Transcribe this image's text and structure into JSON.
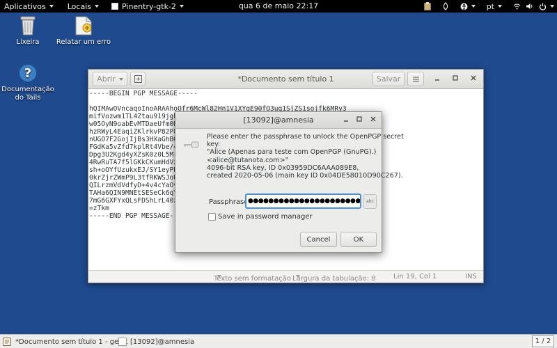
{
  "top_panel": {
    "applications": "Aplicativos",
    "places": "Locais",
    "app_menu": "Pinentry-gtk-2",
    "clock": "qua 6 de maio  22:17",
    "language": "pt"
  },
  "desktop": {
    "icons": [
      {
        "label": "Lixeira",
        "icon": "trash-icon"
      },
      {
        "label": "Relatar um erro",
        "icon": "report-bug-icon"
      },
      {
        "label": "Documentação do Tails",
        "icon": "help-icon"
      }
    ]
  },
  "gedit": {
    "title": "*Documento sem título 1",
    "open_label": "Abrir",
    "save_label": "Salvar",
    "lines": [
      "-----BEGIN PGP MESSAGE-----",
      "",
      "hQIMAwOVncaqoInoARAAhoOfr6McWl82Hn1V1XYqE90fO3uq1SjZS1sojfk6MRy3",
      "mifVozwm1TL4Ztau919jgh",
      "w05OyN9oabEvMTDaeUfm0K",
      "hzRWyL4EaqiZKlrkvP82P8",
      "nUGO7F2GojIjBs3HXaGhBQ",
      "FGdKa5vZfd7kplRt4Vbe/4",
      "Dpg3U2Kgd4yXZsK0z0L5Mr",
      "4RwRuTA7f5lGKkCKumHdVx",
      "sh+oOYfUzukxEJ/SY1eyPB",
      "0krZjrZWmP9L3tfRKWSJoU",
      "QILrzmVdVdfyD+4v4cYaOv",
      "TAHa6QIN9MNEtSESeCk6qY",
      "7mG6GXFYxQLsFDShLrL40z",
      "=zTkm",
      "-----END PGP MESSAGE-----"
    ],
    "status": {
      "format": "Texto sem formatação",
      "tab_width": "Largura da tabulação: 8",
      "position": "Lin 19, Col 1",
      "mode": "INS"
    }
  },
  "dialog": {
    "title": "[13092]@amnesia",
    "message_lines": [
      "Please enter the passphrase to unlock the OpenPGP secret",
      "key:",
      "\"Alice (Apenas para teste com OpenPGP (GnuPG).)",
      "<alice@tutanota.com>\"",
      "4096-bit RSA key, ID 0x03959DC6AAA089E8,",
      "created 2020-05-06 (main key ID 0x04DE58010D90C267)."
    ],
    "passphrase_label": "Passphrase:",
    "passphrase_value": "●●●●●●●●●●●●●●●●●●●●●●●●●●●●●●",
    "abc_label": "abc",
    "save_label": "Save in password manager",
    "cancel_label": "Cancel",
    "ok_label": "OK"
  },
  "taskbar": {
    "tasks": [
      {
        "label": "*Documento sem título 1 - gedit"
      },
      {
        "label": "[13092]@amnesia"
      }
    ],
    "pager": "1 / 2"
  }
}
